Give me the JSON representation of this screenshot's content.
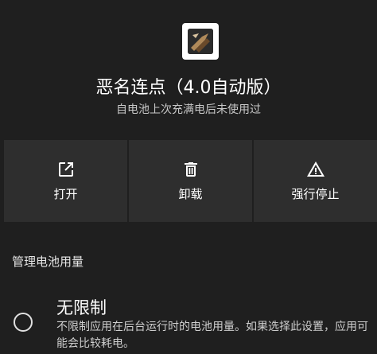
{
  "app": {
    "title": "恶名连点（4.0自动版）",
    "subtitle": "自电池上次充满电后未使用过"
  },
  "actions": [
    {
      "label": "打开",
      "icon": "open-external-icon"
    },
    {
      "label": "卸载",
      "icon": "trash-icon"
    },
    {
      "label": "强行停止",
      "icon": "warning-icon"
    }
  ],
  "battery": {
    "section_title": "管理电池用量",
    "options": [
      {
        "title": "无限制",
        "description": "不限制应用在后台运行时的电池用量。如果选择此设置，应用可能会比较耗电。",
        "selected": false
      }
    ]
  },
  "colors": {
    "background": "#1f1f1f",
    "button_bg": "#2e2e2e",
    "text": "#ffffff",
    "secondary_text": "#c8c8c8"
  }
}
